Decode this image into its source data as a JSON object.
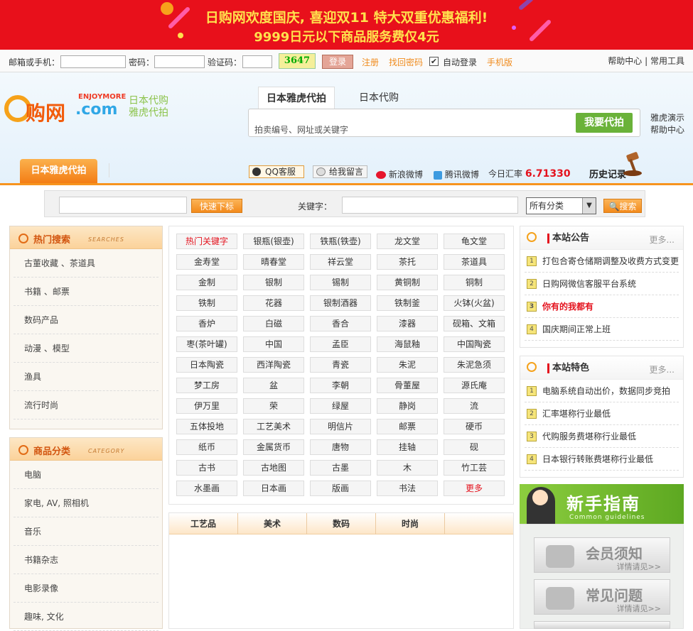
{
  "banner": {
    "line1": "日购网欢度国庆, 喜迎双11  特大双重优惠福利!",
    "line2": "9999日元以下商品服务费仅4元"
  },
  "login": {
    "email_label": "邮箱或手机：",
    "password_label": "密码：",
    "captcha_label": "验证码：",
    "captcha_text": "3647",
    "login_button": "登录",
    "register": "注册",
    "retrieve_password": "找回密码",
    "auto_login": "自动登录",
    "auto_login_checked": "✔",
    "mobile": "手机版",
    "help_center": "帮助中心",
    "separator": "|",
    "tools": "常用工具"
  },
  "header": {
    "logo_main": "购网",
    "logo_com": ".com",
    "logo_enjoy": "ENJOYMORE",
    "slogan1": "日本代购",
    "slogan2": "雅虎代拍",
    "tabs": [
      "日本雅虎代拍",
      "日本代购"
    ],
    "search_placeholder": "拍卖编号、网址或关键字",
    "search_button": "我要代拍",
    "side_links": [
      "雅虎演示",
      "帮助中心"
    ]
  },
  "nav": {
    "tab": "日本雅虎代拍",
    "qq": "QQ客服",
    "leave_message": "给我留言",
    "sina_weibo": "新浪微博",
    "tencent_weibo": "腾讯微博",
    "rate_label": "今日汇率",
    "rate_value": "6.71330",
    "history": "历史记录"
  },
  "quickbar": {
    "bid_button": "快速下标",
    "keyword_label": "关键字：",
    "category_select": "所有分类",
    "search_button": "搜索"
  },
  "hot_search": {
    "title": "热门搜索",
    "title_en": "SEARCHES",
    "items": [
      "古董收藏 、茶道具",
      "书籍 、邮票",
      "数码产品",
      "动漫 、模型",
      "渔具",
      "流行时尚"
    ]
  },
  "categories": {
    "title": "商品分类",
    "title_en": "CATEGORY",
    "items": [
      "电脑",
      "家电, AV, 照相机",
      "音乐",
      "书籍杂志",
      "电影录像",
      "趣味, 文化"
    ]
  },
  "tags": [
    "热门关键字",
    "银瓶(银壶)",
    "铁瓶(铁壶)",
    "龙文堂",
    "龟文堂",
    "金寿堂",
    "晴春堂",
    "祥云堂",
    "茶托",
    "茶道具",
    "金制",
    "银制",
    "锡制",
    "黄铜制",
    "铜制",
    "铁制",
    "花器",
    "银制酒器",
    "铁制釜",
    "火钵(火盆)",
    "香炉",
    "白磁",
    "香合",
    "漆器",
    "砚箱、文箱",
    "枣(茶叶罐)",
    "中国",
    "孟臣",
    "海鼠釉",
    "中国陶瓷",
    "日本陶瓷",
    "西洋陶瓷",
    "青瓷",
    "朱泥",
    "朱泥急须",
    "梦工房",
    "盆",
    "李朝",
    "骨董屋",
    "源氏庵",
    "伊万里",
    "荣",
    "绿屋",
    "静岗",
    "流",
    "五体投地",
    "工艺美术",
    "明信片",
    "邮票",
    "硬币",
    "纸币",
    "金属货币",
    "唐物",
    "挂轴",
    "砚",
    "古书",
    "古地图",
    "古墨",
    "木",
    "竹工芸",
    "水墨画",
    "日本画",
    "版画",
    "书法",
    "更多"
  ],
  "table_tabs": [
    "工艺品",
    "美术",
    "数码",
    "时尚"
  ],
  "notice": {
    "title": "本站公告",
    "more": "更多...",
    "items": [
      "打包合寄仓储期调整及收费方式变更",
      "日购网微信客服平台系统",
      "你有的我都有",
      "国庆期间正常上班"
    ]
  },
  "features": {
    "title": "本站特色",
    "more": "更多...",
    "items": [
      "电脑系统自动出价，数据同步竞拍",
      "汇率堪称行业最低",
      "代购服务费堪称行业最低",
      "日本银行转账费堪称行业最低"
    ]
  },
  "guide": {
    "title": "新手指南",
    "title_en": "Common guidelines",
    "buttons": [
      {
        "title": "会员须知",
        "sub": "详情请见>>"
      },
      {
        "title": "常见问题",
        "sub": "详情请见>>"
      }
    ]
  },
  "colors": {
    "banner": "#e8101b",
    "accent": "#f7941e",
    "green_button": "#6ab239",
    "rate": "#e4121d"
  }
}
